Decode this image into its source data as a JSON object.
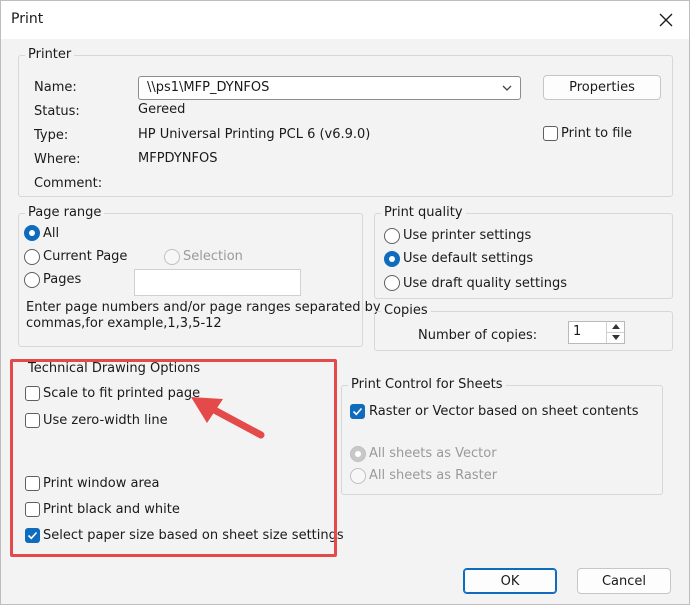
{
  "window": {
    "title": "Print"
  },
  "printer": {
    "legend": "Printer",
    "name_label": "Name:",
    "name_value": "\\\\ps1\\MFP_DYNFOS",
    "status_label": "Status:",
    "status_value": "Gereed",
    "type_label": "Type:",
    "type_value": "HP Universal Printing PCL 6 (v6.9.0)",
    "where_label": "Where:",
    "where_value": "MFPDYNFOS",
    "comment_label": "Comment:",
    "properties_label": "Properties",
    "print_to_file_label": "Print to file"
  },
  "page_range": {
    "legend": "Page range",
    "all_label": "All",
    "current_page_label": "Current Page",
    "selection_label": "Selection",
    "pages_label": "Pages",
    "hint_line1": "Enter page numbers and/or page ranges separated by",
    "hint_line2": "commas,for example,1,3,5-12"
  },
  "print_quality": {
    "legend": "Print quality",
    "printer_settings_label": "Use printer settings",
    "default_settings_label": "Use default settings",
    "draft_settings_label": "Use draft quality settings"
  },
  "copies": {
    "legend": "Copies",
    "number_label": "Number of copies:",
    "number_value": "1"
  },
  "tech_drawing": {
    "legend": "Technical Drawing Options",
    "scale_to_fit_label": "Scale to fit printed page",
    "zero_width_label": "Use zero-width line",
    "print_window_label": "Print window area",
    "black_white_label": "Print black and white",
    "paper_size_label": "Select paper size based on sheet size settings"
  },
  "print_control": {
    "legend": "Print Control for Sheets",
    "raster_vector_label": "Raster or Vector based on sheet contents",
    "all_vector_label": "All sheets as Vector",
    "all_raster_label": "All sheets as Raster"
  },
  "footer": {
    "ok_label": "OK",
    "cancel_label": "Cancel"
  },
  "colors": {
    "accent": "#0f6cbd",
    "annotation": "#e44a4a"
  }
}
